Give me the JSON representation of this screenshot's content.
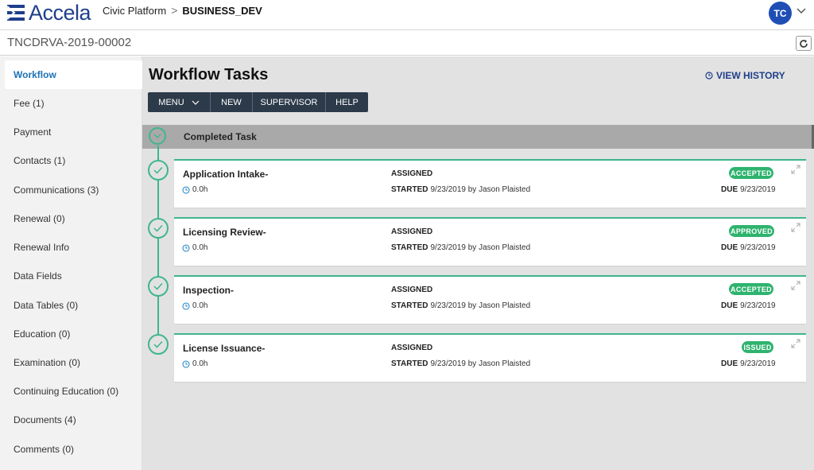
{
  "header": {
    "logo_text": "Accela",
    "breadcrumb_1": "Civic Platform",
    "breadcrumb_sep": ">",
    "breadcrumb_2": "BUSINESS_DEV",
    "user_initials": "TC",
    "brand_color": "#1f3f8a"
  },
  "record": {
    "id": "TNCDRVA-2019-00002"
  },
  "sidebar": {
    "items": [
      {
        "label": "Workflow",
        "active": true
      },
      {
        "label": "Fee (1)"
      },
      {
        "label": "Payment"
      },
      {
        "label": "Contacts (1)"
      },
      {
        "label": "Communications (3)"
      },
      {
        "label": "Renewal (0)"
      },
      {
        "label": "Renewal Info"
      },
      {
        "label": "Data Fields"
      },
      {
        "label": "Data Tables (0)"
      },
      {
        "label": "Education (0)"
      },
      {
        "label": "Examination (0)"
      },
      {
        "label": "Continuing Education (0)"
      },
      {
        "label": "Documents (4)"
      },
      {
        "label": "Comments (0)"
      }
    ]
  },
  "main": {
    "title": "Workflow Tasks",
    "view_history": "VIEW HISTORY",
    "toolbar": {
      "menu": "MENU",
      "new": "NEW",
      "supervisor": "SUPERVISOR",
      "help": "HELP"
    },
    "completed_label": "Completed Task",
    "accent_color": "#3fb68b",
    "tasks": [
      {
        "name": "Application Intake-",
        "hours": "0.0h",
        "assigned": "ASSIGNED",
        "started_label": "STARTED",
        "started_value": "9/23/2019 by Jason Plaisted",
        "status": "ACCEPTED",
        "due_label": "DUE",
        "due_value": "9/23/2019"
      },
      {
        "name": "Licensing Review-",
        "hours": "0.0h",
        "assigned": "ASSIGNED",
        "started_label": "STARTED",
        "started_value": "9/23/2019 by Jason Plaisted",
        "status": "APPROVED",
        "due_label": "DUE",
        "due_value": "9/23/2019"
      },
      {
        "name": "Inspection-",
        "hours": "0.0h",
        "assigned": "ASSIGNED",
        "started_label": "STARTED",
        "started_value": "9/23/2019 by Jason Plaisted",
        "status": "ACCEPTED",
        "due_label": "DUE",
        "due_value": "9/23/2019"
      },
      {
        "name": "License Issuance-",
        "hours": "0.0h",
        "assigned": "ASSIGNED",
        "started_label": "STARTED",
        "started_value": "9/23/2019 by Jason Plaisted",
        "status": "ISSUED",
        "due_label": "DUE",
        "due_value": "9/23/2019"
      }
    ]
  }
}
